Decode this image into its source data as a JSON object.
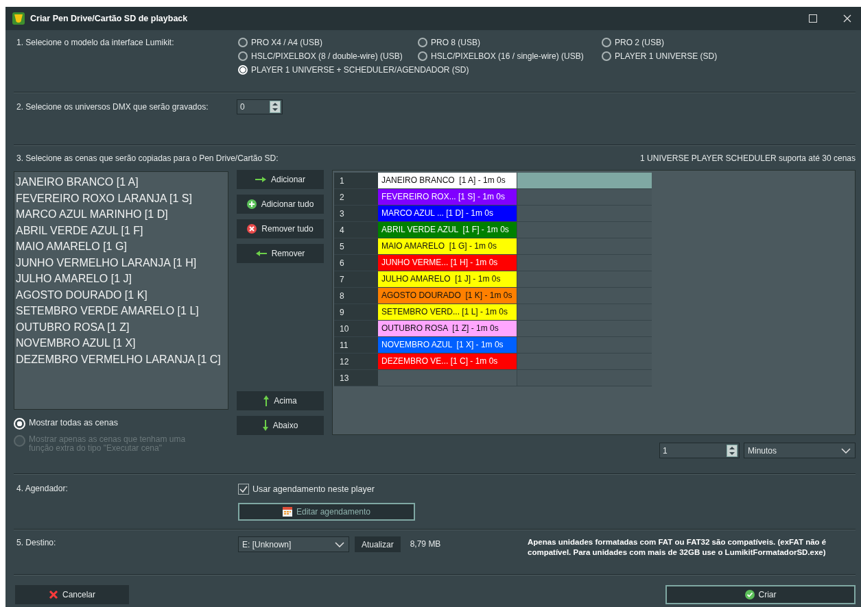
{
  "window": {
    "title": "Criar Pen Drive/Cartão SD de playback"
  },
  "model": {
    "label": "1. Selecione o modelo da interface Lumikit:",
    "options": [
      {
        "label": "PRO X4 / A4 (USB)",
        "selected": false
      },
      {
        "label": "PRO 8 (USB)",
        "selected": false
      },
      {
        "label": "PRO 2 (USB)",
        "selected": false
      },
      {
        "label": "HSLC/PIXELBOX (8 / double-wire)  (USB)",
        "selected": false
      },
      {
        "label": "HSLC/PIXELBOX (16 / single-wire)  (USB)",
        "selected": false
      },
      {
        "label": "PLAYER 1 UNIVERSE (SD)",
        "selected": false
      },
      {
        "label": "PLAYER 1 UNIVERSE + SCHEDULER/AGENDADOR (SD)",
        "selected": true
      }
    ]
  },
  "universes": {
    "label": "2. Selecione os universos DMX que serão gravados:",
    "value": "0"
  },
  "scenes": {
    "label": "3. Selecione as cenas que serão copiadas para o Pen Drive/Cartão SD:",
    "note": "1 UNIVERSE PLAYER SCHEDULER suporta até 30 cenas",
    "available": [
      "JANEIRO BRANCO [1 A]",
      "FEVEREIRO ROXO LARANJA [1 S]",
      "MARCO AZUL MARINHO [1 D]",
      "ABRIL VERDE AZUL [1 F]",
      "MAIO AMARELO [1 G]",
      "JUNHO VERMELHO LARANJA [1 H]",
      "JULHO AMARELO [1 J]",
      "AGOSTO DOURADO [1 K]",
      "SETEMBRO VERDE AMARELO [1 L]",
      "OUTUBRO ROSA [1 Z]",
      "NOVEMBRO AZUL [1 X]",
      "DEZEMBRO VERMELHO LARANJA [1 C]"
    ],
    "buttons": [
      {
        "label": "Adicionar",
        "kind": "right"
      },
      {
        "label": "Adicionar tudo",
        "kind": "plus"
      },
      {
        "label": "Remover tudo",
        "kind": "clear"
      },
      {
        "label": "Remover",
        "kind": "left"
      }
    ],
    "move_buttons": [
      {
        "label": "Acima",
        "kind": "up"
      },
      {
        "label": "Abaixo",
        "kind": "down"
      }
    ],
    "filters": [
      {
        "label": "Mostrar todas as cenas",
        "selected": true,
        "disabled": false
      },
      {
        "label": "Mostrar apenas as cenas que tenham uma função extra do tipo \"Executar cena\"",
        "selected": false,
        "disabled": true
      }
    ],
    "rows": [
      {
        "number": "1",
        "scene": "JANEIRO BRANCO  [1 A] - 1m 0s",
        "color": "#ffffff",
        "selected": true
      },
      {
        "number": "2",
        "scene": "FEVEREIRO ROX... [1 S] - 1m 0s",
        "color": "#8000ff",
        "selected": false
      },
      {
        "number": "3",
        "scene": "MARCO AZUL ... [1 D] - 1m 0s",
        "color": "#0000ff",
        "selected": false
      },
      {
        "number": "4",
        "scene": "ABRIL VERDE AZUL  [1 F] - 1m 0s",
        "color": "#008000",
        "selected": false
      },
      {
        "number": "5",
        "scene": "MAIO AMARELO  [1 G] - 1m 0s",
        "color": "#ffff00",
        "selected": false
      },
      {
        "number": "6",
        "scene": "JUNHO VERME... [1 H] - 1m 0s",
        "color": "#ff0000",
        "selected": false
      },
      {
        "number": "7",
        "scene": "JULHO AMARELO  [1 J] - 1m 0s",
        "color": "#ffff00",
        "selected": false
      },
      {
        "number": "8",
        "scene": "AGOSTO DOURADO  [1 K] - 1m 0s",
        "color": "#ff8000",
        "selected": false
      },
      {
        "number": "9",
        "scene": "SETEMBRO VERD... [1 L] - 1m 0s",
        "color": "#ffff00",
        "selected": false
      },
      {
        "number": "10",
        "scene": "OUTUBRO ROSA  [1 Z] - 1m 0s",
        "color": "#ffa6ff",
        "selected": false
      },
      {
        "number": "11",
        "scene": "NOVEMBRO AZUL  [1 X] - 1m 0s",
        "color": "#0060ff",
        "selected": false
      },
      {
        "number": "12",
        "scene": "DEZEMBRO VE... [1 C] - 1m 0s",
        "color": "#ff0000",
        "selected": false
      },
      {
        "number": "13",
        "selected": false
      }
    ],
    "duration": {
      "value": "1",
      "unit": "Minutos"
    }
  },
  "scheduler": {
    "label": "4. Agendador:",
    "checkbox": {
      "label": "Usar agendamento neste player",
      "checked": true
    },
    "button": "Editar agendamento"
  },
  "destination": {
    "label": "5. Destino:",
    "drive": "E: [Unknown]",
    "refresh": "Atualizar",
    "size": "8,79 MB",
    "note": "Apenas unidades formatadas com FAT ou FAT32 são compatíveis. (exFAT não é compatível. Para unidades com mais de 32GB use o LumikitFormatadorSD.exe)"
  },
  "footer": {
    "cancel": "Cancelar",
    "create": "Criar"
  }
}
